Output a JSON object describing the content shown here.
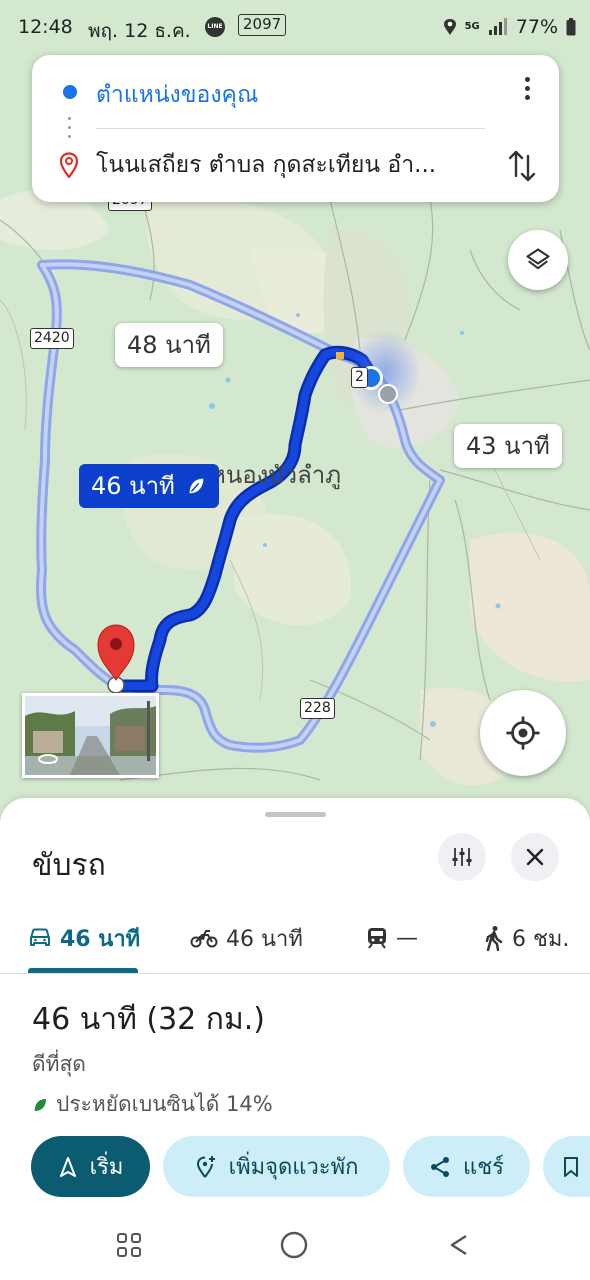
{
  "status_bar": {
    "time": "12:48",
    "date": "พฤ. 12 ธ.ค.",
    "line_badge": "LINE",
    "route_badge": "2097",
    "network": "5G",
    "battery": "77%"
  },
  "directions": {
    "origin": "ตำแหน่งของคุณ",
    "destination": "โนนเสถียร ตำบล กุดสะเทียน อำ..."
  },
  "map": {
    "route_labels": {
      "alt_north": "48 นาที",
      "alt_east": "43 นาที",
      "selected": "46 นาที"
    },
    "place_name": "หนองบัวลำภู",
    "road_shields": {
      "top": "2097",
      "left": "2420",
      "junction": "2",
      "bottom": "228"
    }
  },
  "sheet": {
    "title": "ขับรถ",
    "modes": [
      {
        "icon": "car-icon",
        "label": "46 นาที"
      },
      {
        "icon": "motorcycle-icon",
        "label": "46 นาที"
      },
      {
        "icon": "train-icon",
        "label": "—"
      },
      {
        "icon": "walk-icon",
        "label": "6 ชม."
      }
    ],
    "summary": "46 นาที (32 กม.)",
    "best_label": "ดีที่สุด",
    "eco_label": "ประหยัดเบนซินได้ 14%",
    "actions": {
      "start": "เริ่ม",
      "add_stop": "เพิ่มจุดแวะพัก",
      "share": "แชร์"
    }
  },
  "colors": {
    "map_background": "#d3e8cf",
    "selected_route": "#0b3fcc",
    "alt_route": "#8fa6ea",
    "primary_button": "#0b5c70",
    "secondary_button": "#cdeef8",
    "active_mode": "#0b6b85"
  }
}
